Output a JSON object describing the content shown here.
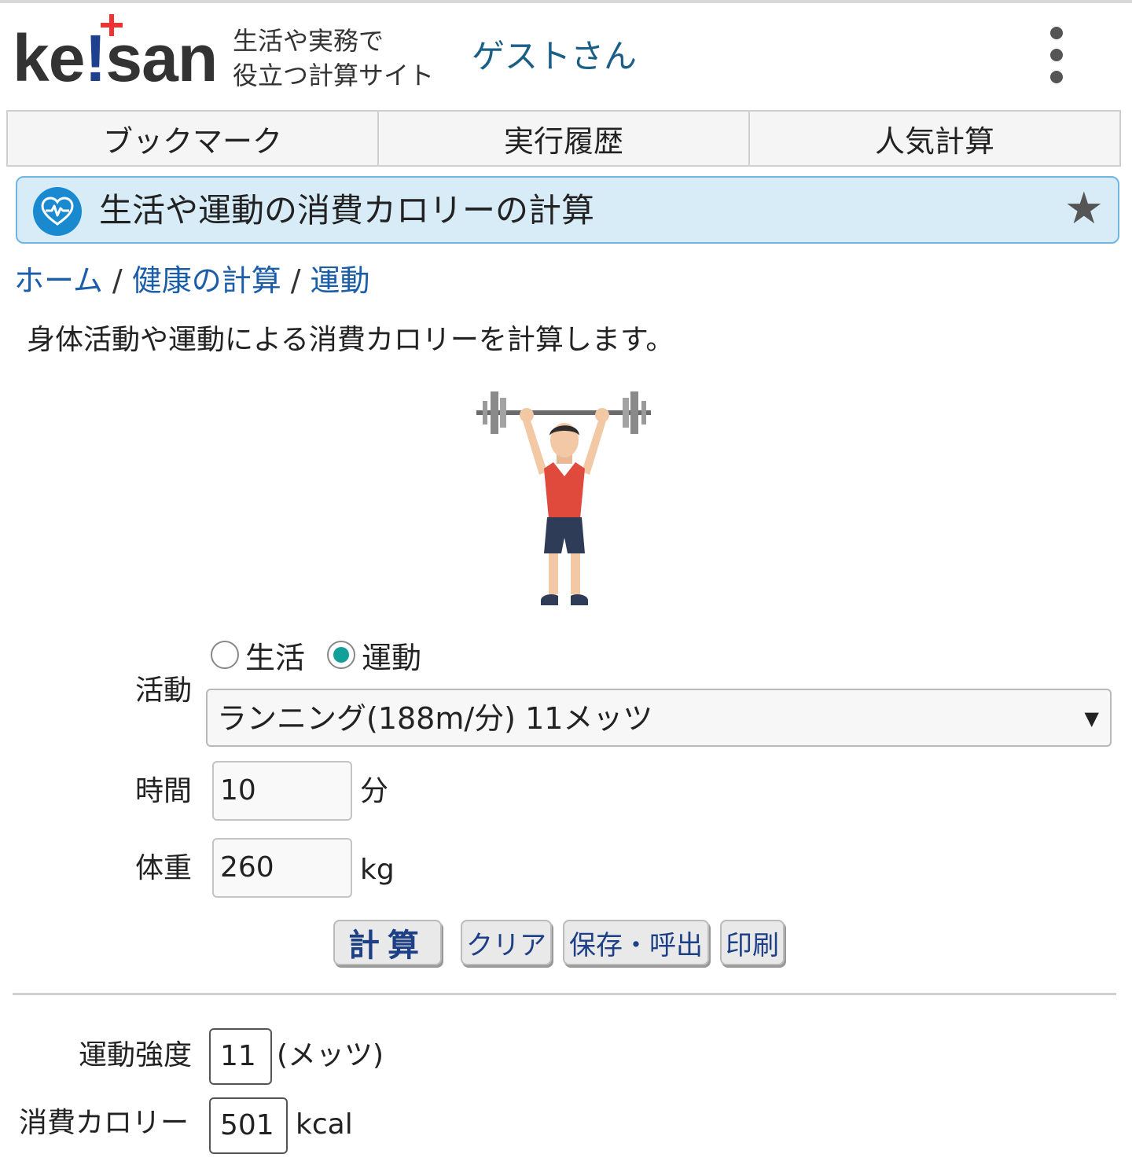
{
  "header": {
    "logo": "ke!san",
    "tagline_line1": "生活や実務で",
    "tagline_line2": "役立つ計算サイト",
    "user": "ゲストさん"
  },
  "tabs": [
    {
      "label": "ブックマーク"
    },
    {
      "label": "実行履歴"
    },
    {
      "label": "人気計算"
    }
  ],
  "page": {
    "title": "生活や運動の消費カロリーの計算",
    "description": "身体活動や運動による消費カロリーを計算します。"
  },
  "breadcrumb": {
    "home": "ホーム",
    "category": "健康の計算",
    "current": "運動",
    "separator": "/"
  },
  "form": {
    "activity_label": "活動",
    "radio_life": "生活",
    "radio_exercise": "運動",
    "selected_radio": "運動",
    "activity_value": "ランニング(188m/分) 11メッツ",
    "time_label": "時間",
    "time_value": "10",
    "time_unit": "分",
    "weight_label": "体重",
    "weight_value": "260",
    "weight_unit": "kg"
  },
  "buttons": {
    "calculate": "計算",
    "clear": "クリア",
    "save": "保存・呼出",
    "print": "印刷"
  },
  "result": {
    "intensity_label": "運動強度",
    "intensity_value": "11",
    "intensity_unit": "(メッツ)",
    "calorie_label": "消費カロリー",
    "calorie_value": "501",
    "calorie_unit": "kcal"
  },
  "colors": {
    "link": "#1a5da8",
    "title_bg": "#d8ecf8",
    "radio_on": "#13a09b",
    "button_text": "#1d3f86"
  },
  "icons": [
    "heart-pulse-icon",
    "star-icon",
    "kebab-menu-icon",
    "dropdown-arrow-icon"
  ]
}
